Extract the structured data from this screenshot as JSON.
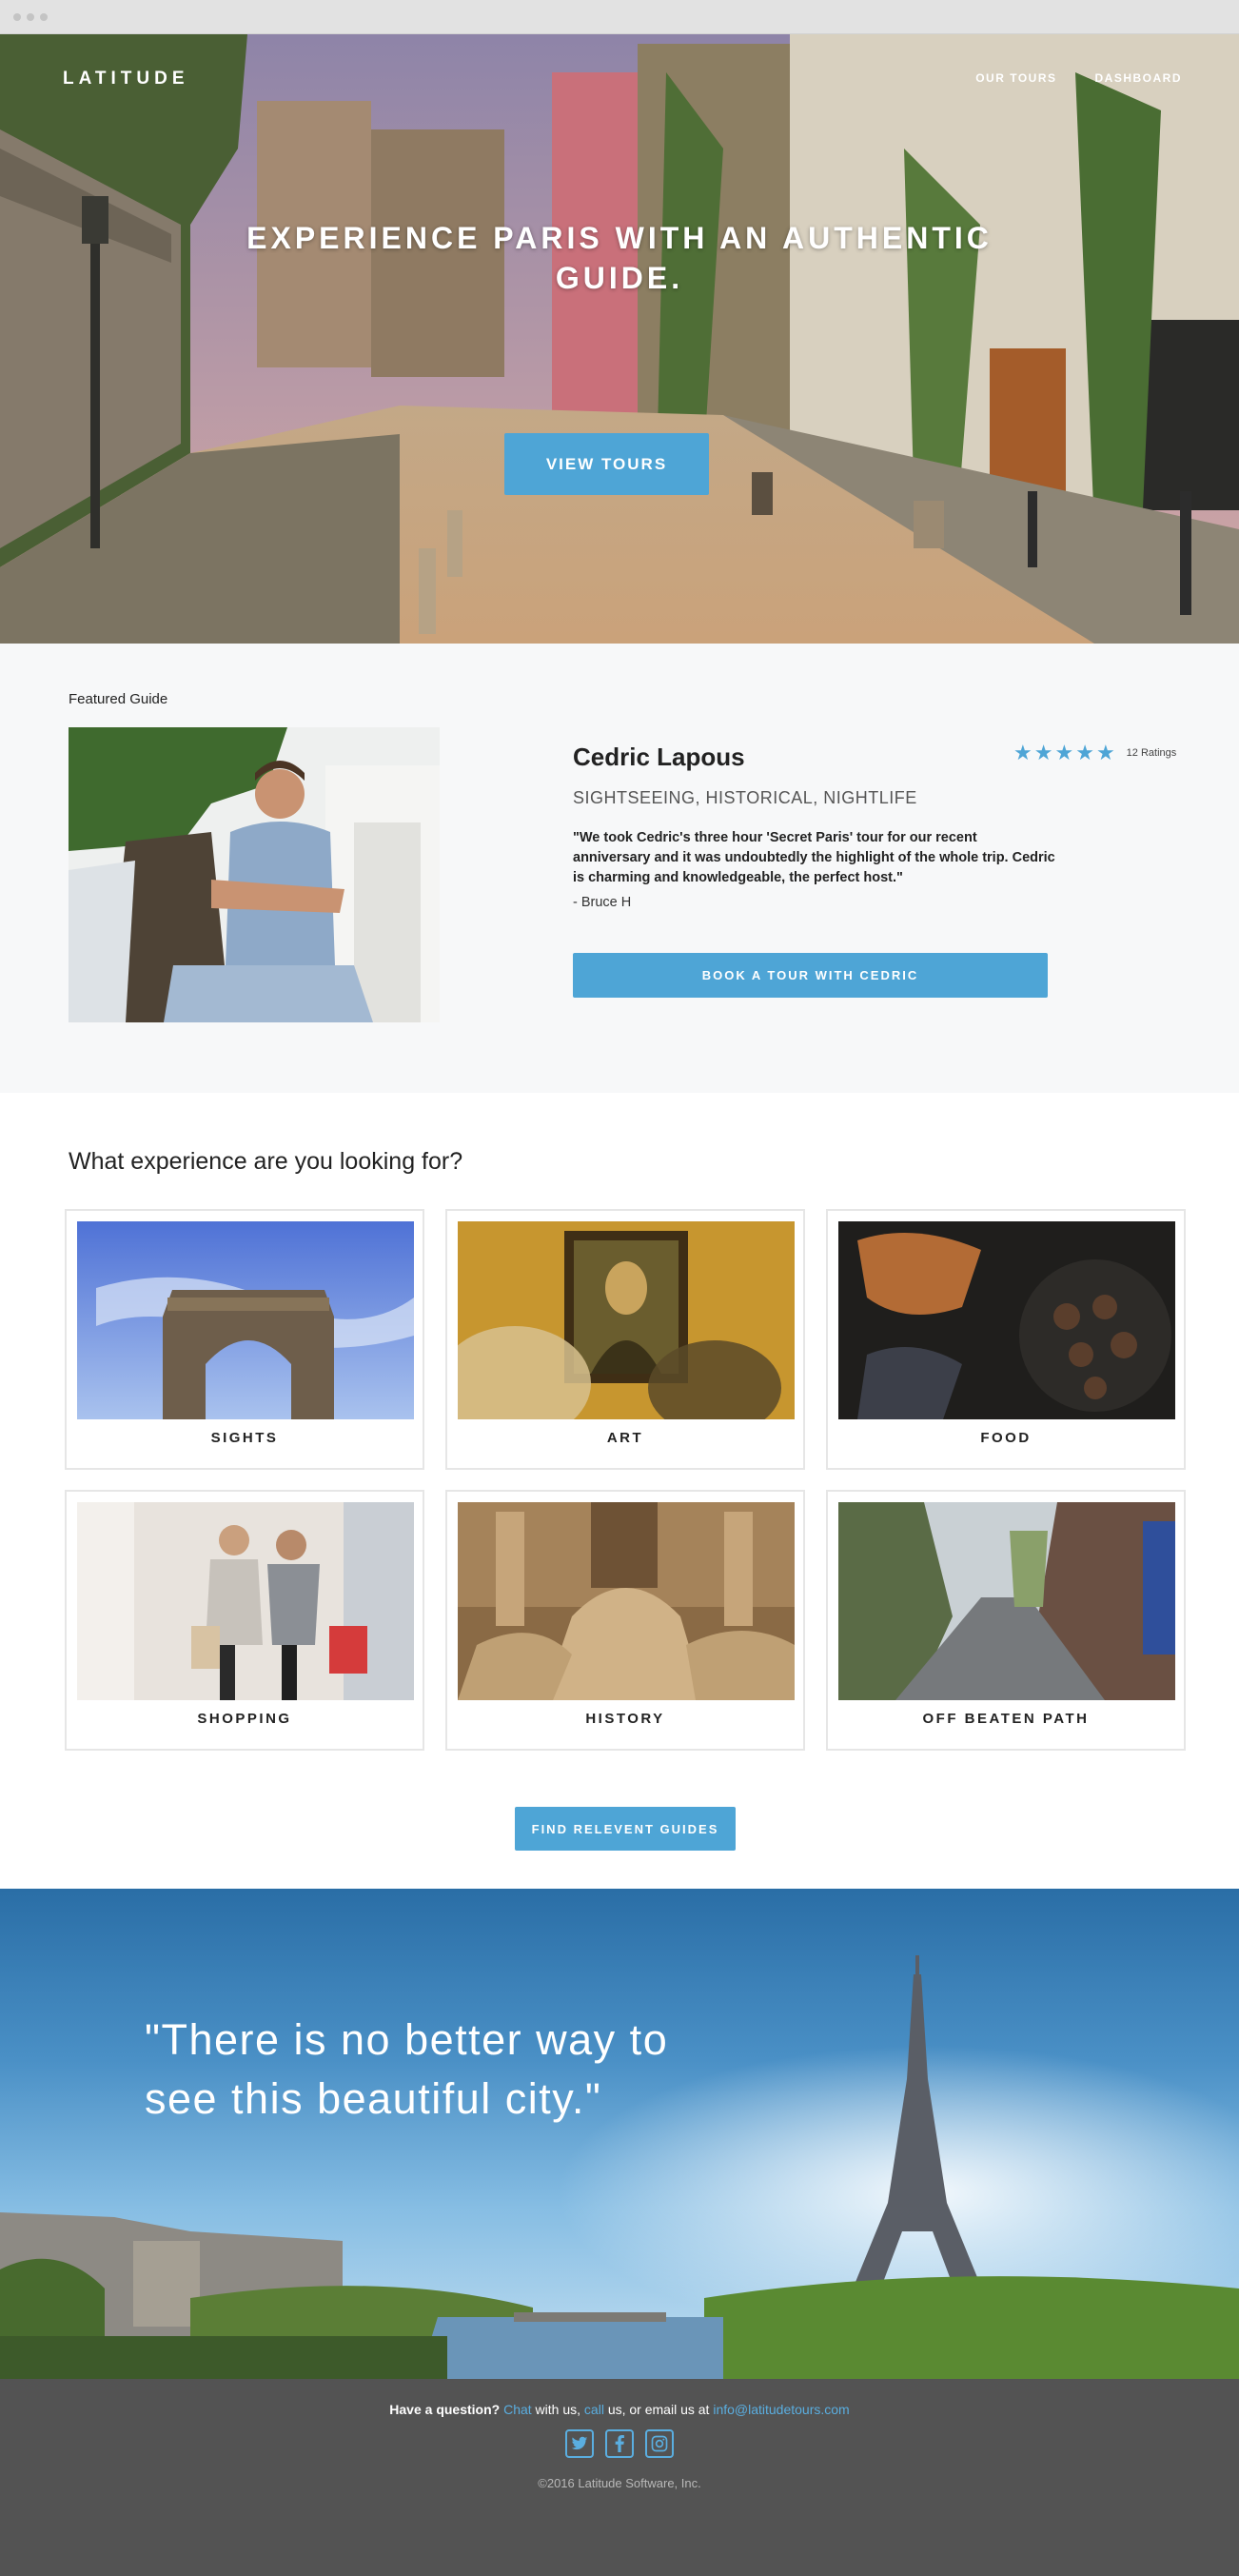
{
  "brand": {
    "logo": "LATITUDE",
    "accent": "#4ea5d6"
  },
  "nav": {
    "items": [
      "OUR TOURS",
      "DASHBOARD"
    ]
  },
  "hero": {
    "headline": "EXPERIENCE PARIS WITH AN AUTHENTIC GUIDE.",
    "cta_label": "VIEW TOURS"
  },
  "featured": {
    "section_label": "Featured Guide",
    "guide_name": "Cedric Lapous",
    "specialties": "SIGHTSEEING, HISTORICAL, NIGHTLIFE",
    "rating": {
      "stars": 5,
      "ratings_text": "12 Ratings"
    },
    "review_quote": "\"We took Cedric's three hour 'Secret Paris' tour for our recent anniversary and it was undoubtedly the highlight of the whole trip. Cedric is charming and knowledgeable, the perfect host.\"",
    "review_author": "- Bruce H",
    "book_button": "BOOK A TOUR WITH CEDRIC"
  },
  "experience": {
    "heading": "What experience are you looking for?",
    "cards": [
      {
        "label": "SIGHTS"
      },
      {
        "label": "ART"
      },
      {
        "label": "FOOD"
      },
      {
        "label": "SHOPPING"
      },
      {
        "label": "HISTORY"
      },
      {
        "label": "OFF BEATEN PATH"
      }
    ],
    "find_button": "FIND RELEVENT GUIDES"
  },
  "banner": {
    "quote": "\"There is no better way to see this beautiful city.\""
  },
  "footer": {
    "question": "Have a question?",
    "chat_link": "Chat",
    "text_1": " with us, ",
    "call_link": "call",
    "text_2": " us, or email us at ",
    "email": "info@latitudetours.com",
    "socials": [
      "twitter-icon",
      "facebook-icon",
      "instagram-icon"
    ],
    "copyright": "©2016 Latitude Software, Inc."
  }
}
